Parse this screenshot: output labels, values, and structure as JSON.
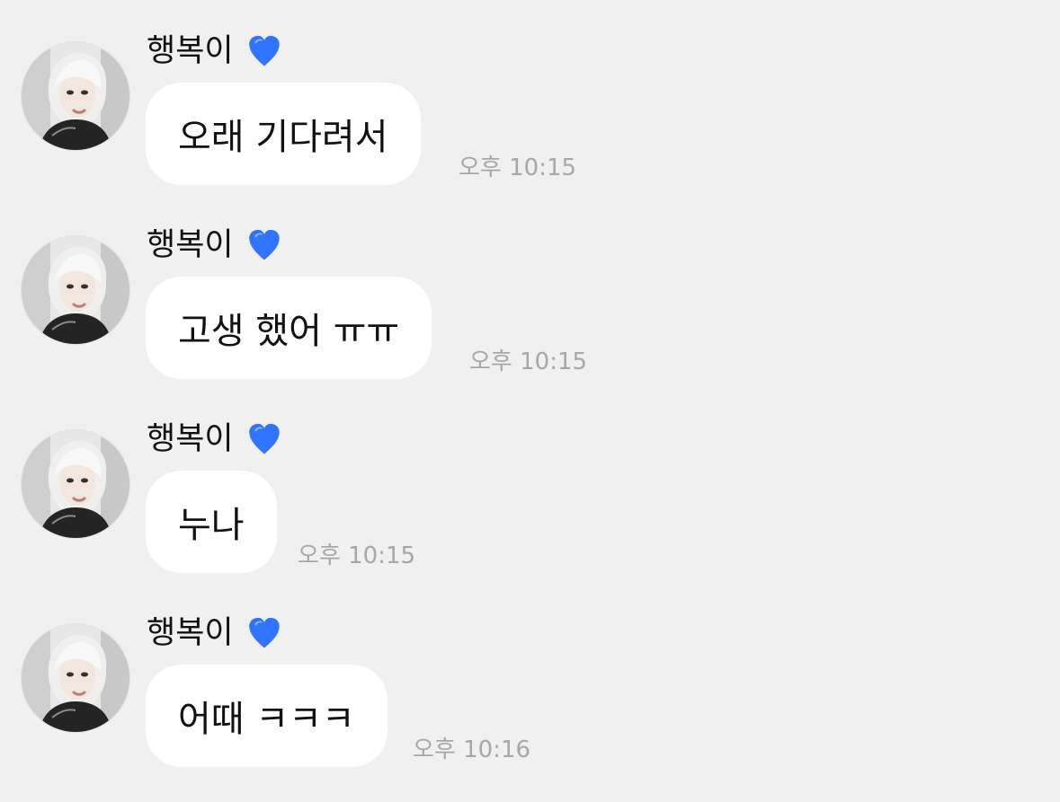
{
  "chat": {
    "messages": [
      {
        "sender": "행복이",
        "emoji": "blue-heart-icon",
        "text": "오래 기다려서",
        "time": "오후 10:15"
      },
      {
        "sender": "행복이",
        "emoji": "blue-heart-icon",
        "text": "고생 했어 ㅠㅠ",
        "time": "오후 10:15"
      },
      {
        "sender": "행복이",
        "emoji": "blue-heart-icon",
        "text": "누나",
        "time": "오후 10:15"
      },
      {
        "sender": "행복이",
        "emoji": "blue-heart-icon",
        "text": "어때 ㅋㅋㅋ",
        "time": "오후 10:16"
      }
    ]
  },
  "colors": {
    "background": "#f0f0f0",
    "bubble": "#ffffff",
    "heart": "#2f73ff",
    "time": "#a7a7a7"
  }
}
